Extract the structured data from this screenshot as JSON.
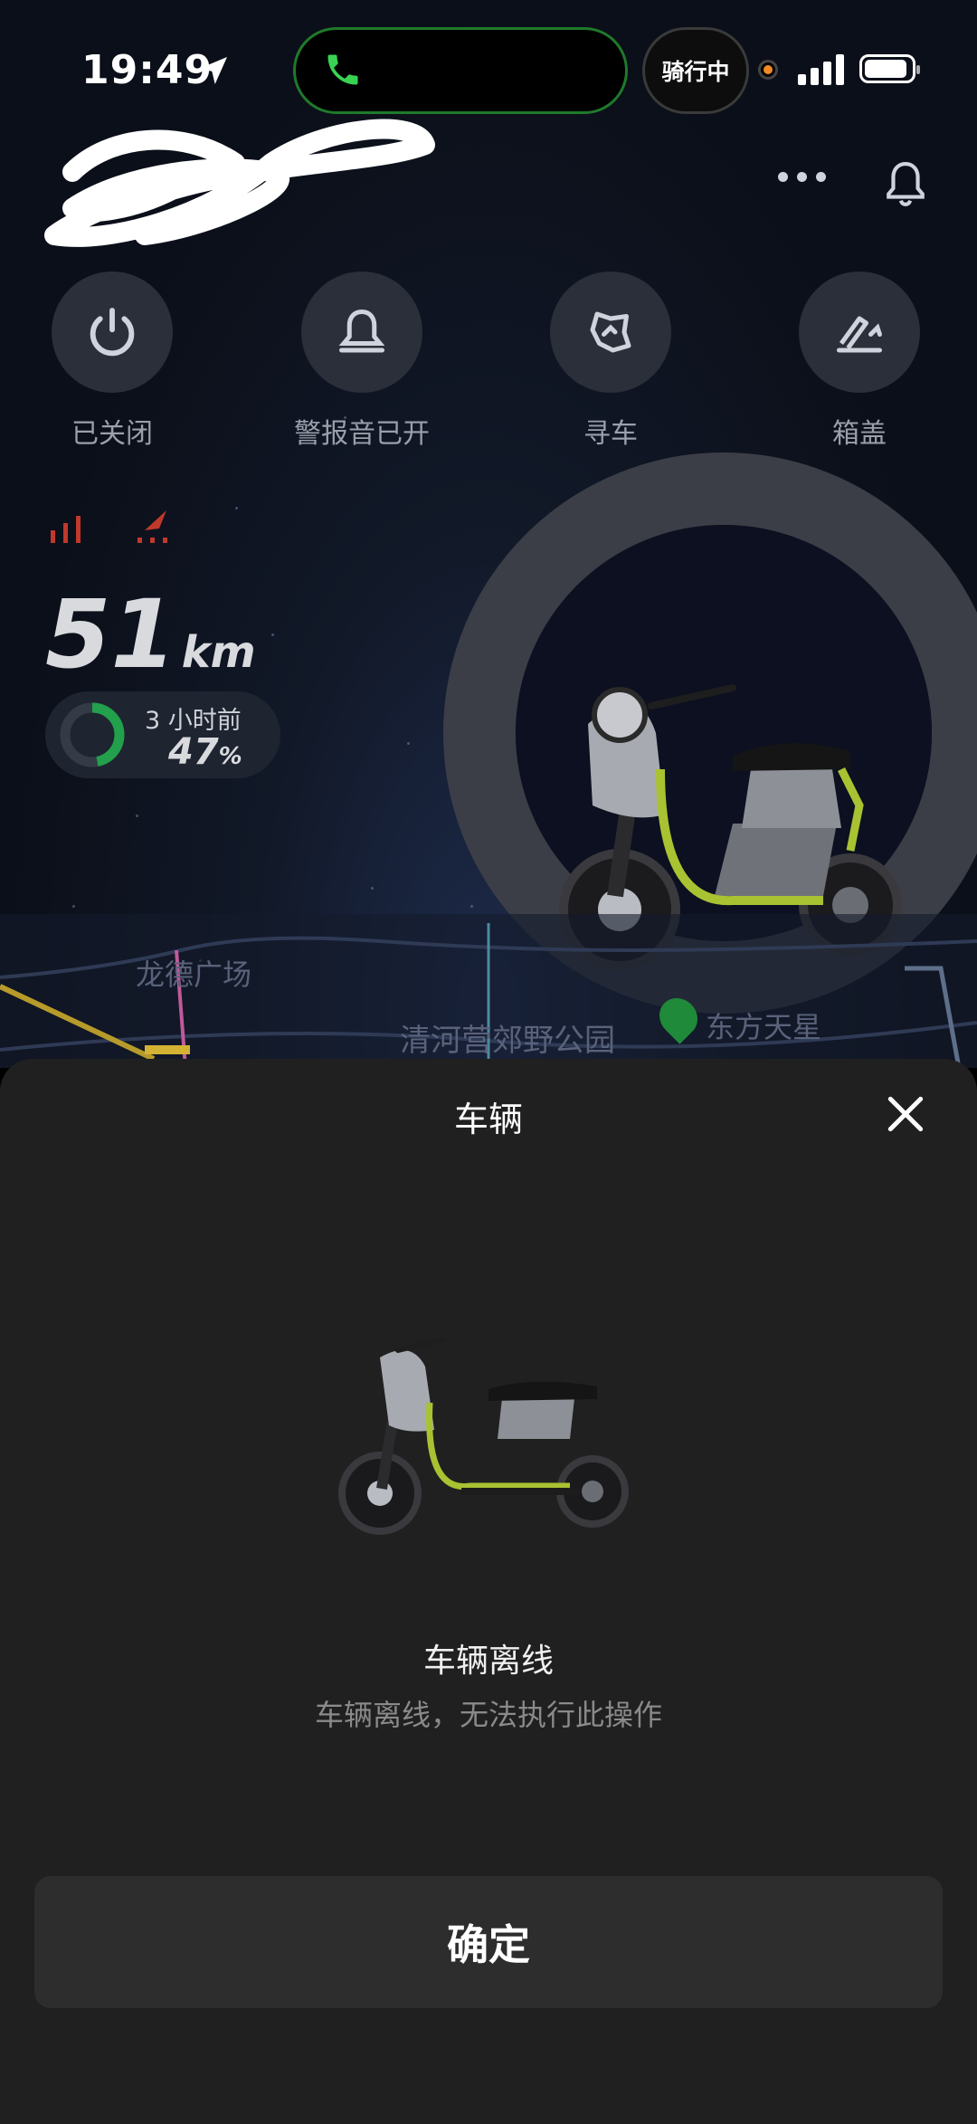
{
  "status_bar": {
    "time": "19:49",
    "activity": "骑行中"
  },
  "actions": [
    {
      "label": "已关闭",
      "icon": "power-icon"
    },
    {
      "label": "警报音已开",
      "icon": "bell-icon"
    },
    {
      "label": "寻车",
      "icon": "find-vehicle-icon"
    },
    {
      "label": "箱盖",
      "icon": "trunk-lid-icon"
    }
  ],
  "stats": {
    "range_value": "51",
    "range_unit": "km",
    "battery_updated": "3 小时前",
    "battery_value": "47",
    "battery_unit": "%",
    "battery_fraction": 0.47,
    "battery_color": "#22a04b"
  },
  "map": {
    "labels": [
      "龙德广场",
      "清河营郊野公园",
      "东方天星"
    ]
  },
  "sheet": {
    "title": "车辆",
    "status_title": "车辆离线",
    "status_message": "车辆离线，无法执行此操作",
    "confirm_label": "确定"
  }
}
